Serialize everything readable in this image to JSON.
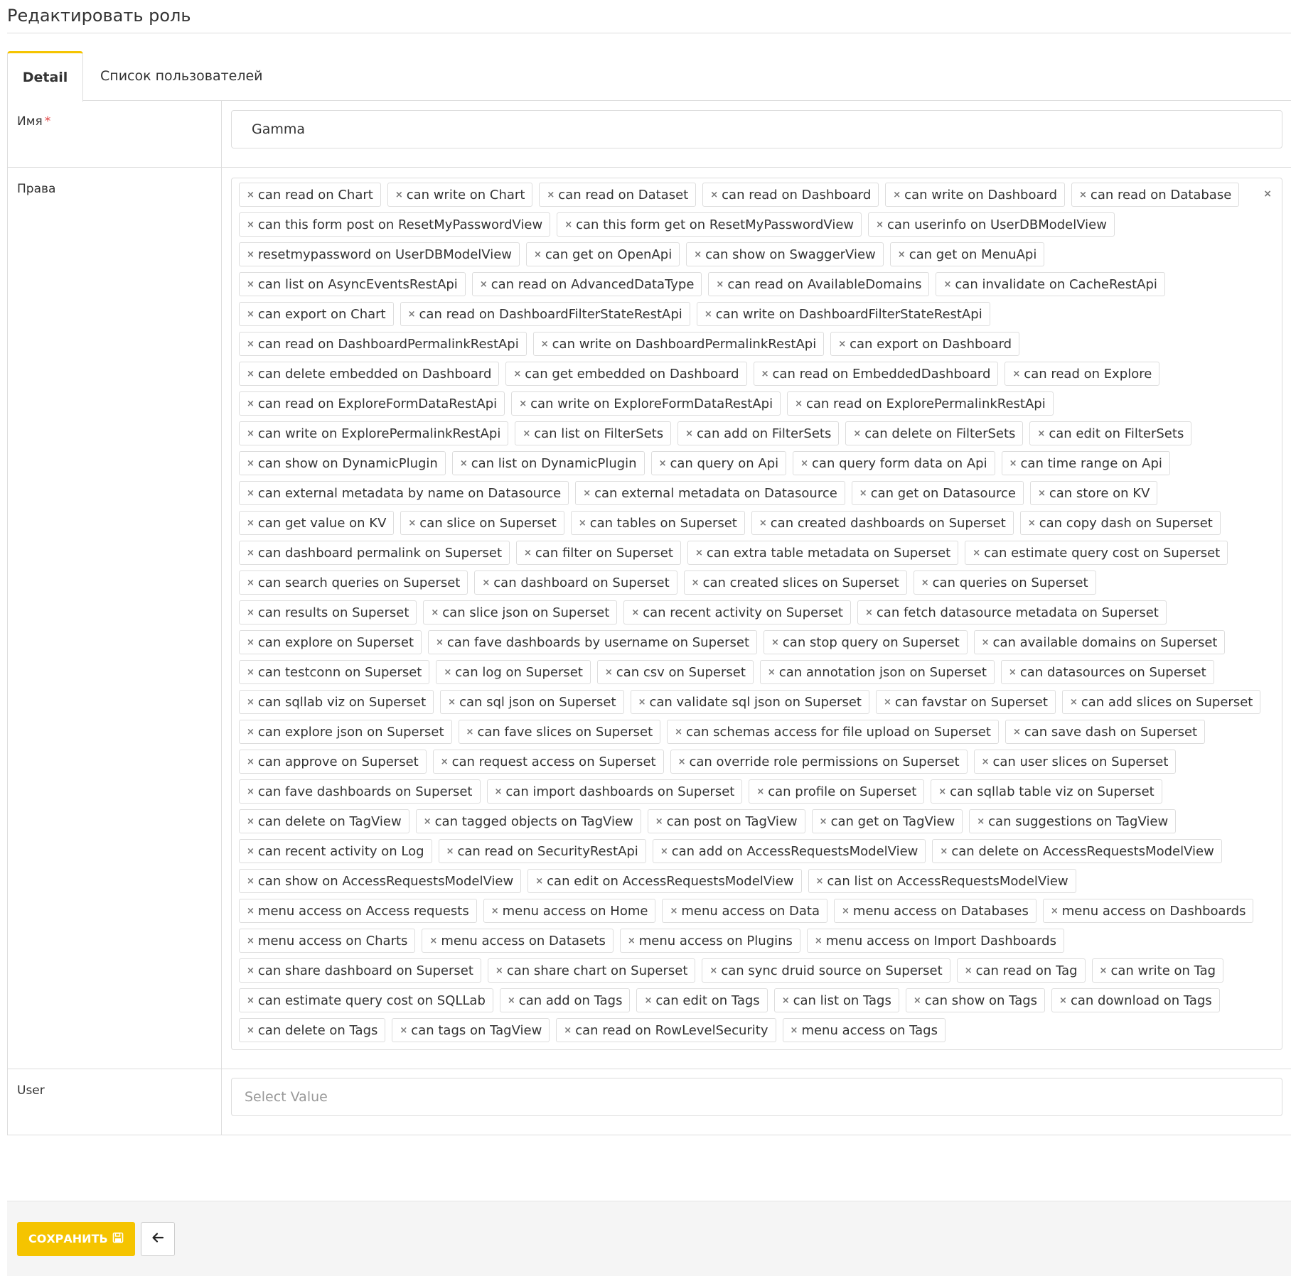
{
  "page": {
    "title": "Редактировать роль"
  },
  "tabs": [
    {
      "label": "Detail",
      "active": true
    },
    {
      "label": "Список пользователей",
      "active": false
    }
  ],
  "form": {
    "name": {
      "label": "Имя",
      "required_mark": "*",
      "value": "Gamma"
    },
    "permissions": {
      "label": "Права",
      "clear_icon": "×",
      "tags": [
        "can read on Chart",
        "can write on Chart",
        "can read on Dataset",
        "can read on Dashboard",
        "can write on Dashboard",
        "can read on Database",
        "can this form post on ResetMyPasswordView",
        "can this form get on ResetMyPasswordView",
        "can userinfo on UserDBModelView",
        "resetmypassword on UserDBModelView",
        "can get on OpenApi",
        "can show on SwaggerView",
        "can get on MenuApi",
        "can list on AsyncEventsRestApi",
        "can read on AdvancedDataType",
        "can read on AvailableDomains",
        "can invalidate on CacheRestApi",
        "can export on Chart",
        "can read on DashboardFilterStateRestApi",
        "can write on DashboardFilterStateRestApi",
        "can read on DashboardPermalinkRestApi",
        "can write on DashboardPermalinkRestApi",
        "can export on Dashboard",
        "can delete embedded on Dashboard",
        "can get embedded on Dashboard",
        "can read on EmbeddedDashboard",
        "can read on Explore",
        "can read on ExploreFormDataRestApi",
        "can write on ExploreFormDataRestApi",
        "can read on ExplorePermalinkRestApi",
        "can write on ExplorePermalinkRestApi",
        "can list on FilterSets",
        "can add on FilterSets",
        "can delete on FilterSets",
        "can edit on FilterSets",
        "can show on DynamicPlugin",
        "can list on DynamicPlugin",
        "can query on Api",
        "can query form data on Api",
        "can time range on Api",
        "can external metadata by name on Datasource",
        "can external metadata on Datasource",
        "can get on Datasource",
        "can store on KV",
        "can get value on KV",
        "can slice on Superset",
        "can tables on Superset",
        "can created dashboards on Superset",
        "can copy dash on Superset",
        "can dashboard permalink on Superset",
        "can filter on Superset",
        "can extra table metadata on Superset",
        "can estimate query cost on Superset",
        "can search queries on Superset",
        "can dashboard on Superset",
        "can created slices on Superset",
        "can queries on Superset",
        "can results on Superset",
        "can slice json on Superset",
        "can recent activity on Superset",
        "can fetch datasource metadata on Superset",
        "can explore on Superset",
        "can fave dashboards by username on Superset",
        "can stop query on Superset",
        "can available domains on Superset",
        "can testconn on Superset",
        "can log on Superset",
        "can csv on Superset",
        "can annotation json on Superset",
        "can datasources on Superset",
        "can sqllab viz on Superset",
        "can sql json on Superset",
        "can validate sql json on Superset",
        "can favstar on Superset",
        "can add slices on Superset",
        "can explore json on Superset",
        "can fave slices on Superset",
        "can schemas access for file upload on Superset",
        "can save dash on Superset",
        "can approve on Superset",
        "can request access on Superset",
        "can override role permissions on Superset",
        "can user slices on Superset",
        "can fave dashboards on Superset",
        "can import dashboards on Superset",
        "can profile on Superset",
        "can sqllab table viz on Superset",
        "can delete on TagView",
        "can tagged objects on TagView",
        "can post on TagView",
        "can get on TagView",
        "can suggestions on TagView",
        "can recent activity on Log",
        "can read on SecurityRestApi",
        "can add on AccessRequestsModelView",
        "can delete on AccessRequestsModelView",
        "can show on AccessRequestsModelView",
        "can edit on AccessRequestsModelView",
        "can list on AccessRequestsModelView",
        "menu access on Access requests",
        "menu access on Home",
        "menu access on Data",
        "menu access on Databases",
        "menu access on Dashboards",
        "menu access on Charts",
        "menu access on Datasets",
        "menu access on Plugins",
        "menu access on Import Dashboards",
        "can share dashboard on Superset",
        "can share chart on Superset",
        "can sync druid source on Superset",
        "can read on Tag",
        "can write on Tag",
        "can estimate query cost on SQLLab",
        "can add on Tags",
        "can edit on Tags",
        "can list on Tags",
        "can show on Tags",
        "can download on Tags",
        "can delete on Tags",
        "can tags on TagView",
        "can read on RowLevelSecurity",
        "menu access on Tags"
      ]
    },
    "user": {
      "label": "User",
      "placeholder": "Select Value"
    }
  },
  "footer": {
    "save_label": "СОХРАНИТЬ",
    "save_icon": "floppy-disk-icon",
    "back_icon": "arrow-left-icon"
  },
  "colors": {
    "accent": "#f5c400",
    "border": "#dddddd"
  }
}
